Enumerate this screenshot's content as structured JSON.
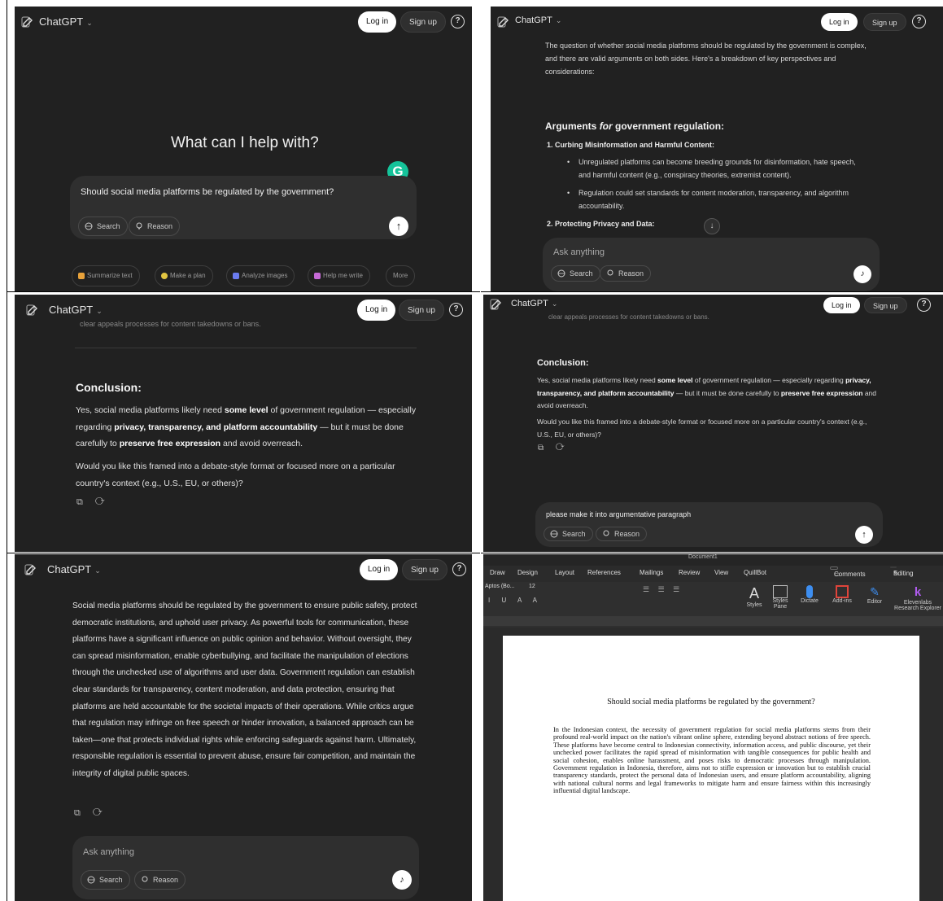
{
  "common": {
    "app_title": "ChatGPT",
    "login": "Log in",
    "signup": "Sign up",
    "help": "?",
    "search_btn": "Search",
    "reason_btn": "Reason",
    "ask_placeholder": "Ask anything"
  },
  "panel1": {
    "heading": "What can I help with?",
    "composer_text": "Should social media platforms be regulated by the government?",
    "grammarly": "G",
    "suggestions": [
      "Summarize text",
      "Make a plan",
      "Analyze images",
      "Help me write",
      "More"
    ]
  },
  "panel2": {
    "intro": "The question of whether social media platforms should be regulated by the government is complex, and there are valid arguments on both sides. Here's a breakdown of key perspectives and considerations:",
    "section_heading_pre": "Arguments ",
    "section_heading_em": "for",
    "section_heading_post": " government regulation:",
    "item1": "1.   Curbing Misinformation and Harmful Content:",
    "item1_b1": "Unregulated platforms can become breeding grounds for disinformation, hate speech, and harmful content (e.g., conspiracy theories, extremist content).",
    "item1_b2": "Regulation could set standards for content moderation, transparency, and algorithm accountability.",
    "item2": "2.   Protecting Privacy and Data:"
  },
  "panel3": {
    "cut_line": "clear appeals processes for content takedowns or bans.",
    "conclusion_heading": "Conclusion:",
    "c1": "Yes, social media platforms likely need ",
    "c2": "some level",
    "c3": " of government regulation — especially regarding ",
    "c4": "privacy, transparency, and platform accountability",
    "c5": " — but it must be done carefully to ",
    "c6": "preserve free expression",
    "c7": " and avoid overreach.",
    "followup": "Would you like this framed into a debate-style format or focused more on a particular country's context (e.g., U.S., EU, or others)?",
    "actions": "⧉ ⟳"
  },
  "panel4": {
    "composer_text": "please make it into argumentative paragraph"
  },
  "panel5": {
    "paragraph": "Social media platforms should be regulated by the government to ensure public safety, protect democratic institutions, and uphold user privacy. As powerful tools for communication, these platforms have a significant influence on public opinion and behavior. Without oversight, they can spread misinformation, enable cyberbullying, and facilitate the manipulation of elections through the unchecked use of algorithms and user data. Government regulation can establish clear standards for transparency, content moderation, and data protection, ensuring that platforms are held accountable for the societal impacts of their operations. While critics argue that regulation may infringe on free speech or hinder innovation, a balanced approach can be taken—one that protects individual rights while enforcing safeguards against harm. Ultimately, responsible regulation is essential to prevent abuse, ensure fair competition, and maintain the integrity of digital public spaces."
  },
  "word": {
    "window_title": "Document1",
    "tabs": [
      "Draw",
      "Design",
      "Layout",
      "References",
      "Mailings",
      "Review",
      "View",
      "QuillBot"
    ],
    "comments": "Comments",
    "editing": "Editing",
    "ribbon_buttons": [
      "Styles",
      "Styles Pane",
      "Dictate",
      "Add-ins",
      "Editor",
      "Elevenlabs Research Explorer"
    ],
    "font_name": "Aptos (Bo...",
    "font_size": "12",
    "doc_title": "Should social media platforms be regulated by the government?",
    "doc_body": "In the Indonesian context, the necessity of government regulation for social media platforms stems from their profound real-world impact on the nation's vibrant online sphere, extending beyond abstract notions of free speech. These platforms have become central to Indonesian connectivity, information access, and public discourse, yet their unchecked power facilitates the rapid spread of misinformation with tangible consequences for public health and social cohesion, enables online harassment, and poses risks to democratic processes through manipulation. Government regulation in Indonesia, therefore, aims not to stifle expression or innovation but to establish crucial transparency standards, protect the personal data of Indonesian users, and ensure platform accountability, aligning with national cultural norms and legal frameworks to mitigate harm and ensure fairness within this increasingly influential digital landscape."
  }
}
